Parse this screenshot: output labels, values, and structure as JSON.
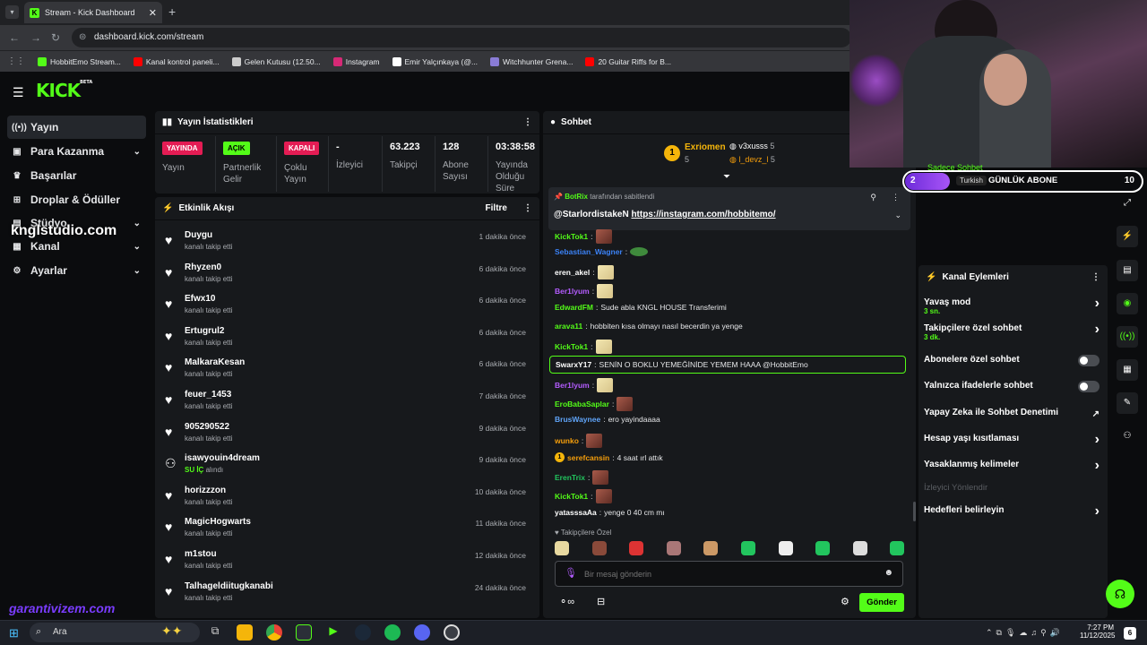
{
  "browser": {
    "tab_title": "Stream - Kick Dashboard",
    "url": "dashboard.kick.com/stream",
    "bookmarks": [
      {
        "label": "HobbitEmo Stream...",
        "color": "#53fc18"
      },
      {
        "label": "Kanal kontrol paneli...",
        "color": "#ff0000"
      },
      {
        "label": "Gelen Kutusu (12.50...",
        "color": "#cccccc"
      },
      {
        "label": "Instagram",
        "color": "#d62976"
      },
      {
        "label": "Emir Yalçınkaya (@...",
        "color": "#ffffff"
      },
      {
        "label": "Witchhunter Grena...",
        "color": "#8a7cd6"
      },
      {
        "label": "20 Guitar Riffs for B...",
        "color": "#ff0000"
      }
    ]
  },
  "brand": {
    "logo": "KICK",
    "beta": "BETA"
  },
  "sidebar": {
    "items": [
      {
        "label": "Yayın",
        "icon": "broadcast-icon",
        "glyph": "((•))"
      },
      {
        "label": "Para Kazanma",
        "icon": "money-icon",
        "glyph": "▣"
      },
      {
        "label": "Başarılar",
        "icon": "trophy-icon",
        "glyph": "♛"
      },
      {
        "label": "Droplar & Ödüller",
        "icon": "gift-icon",
        "glyph": "⊞"
      },
      {
        "label": "Stüdyo",
        "icon": "studio-icon",
        "glyph": "▤"
      },
      {
        "label": "Kanal",
        "icon": "channel-icon",
        "glyph": "▦"
      },
      {
        "label": "Ayarlar",
        "icon": "settings-icon",
        "glyph": "⚙"
      }
    ],
    "watermark": "knglstudio.com",
    "watermark2": "garantivizem.com"
  },
  "stats": {
    "title": "Yayın İstatistikleri",
    "cells": [
      {
        "badge": "YAYINDA",
        "badge_color": "#e41c54",
        "label": "Yayın"
      },
      {
        "badge": "AÇIK",
        "badge_color": "#53fc18",
        "label": "Partnerlik Gelir"
      },
      {
        "badge": "KAPALI",
        "badge_color": "#e41c54",
        "label": "Çoklu Yayın"
      },
      {
        "value": "-",
        "label": "İzleyici"
      },
      {
        "value": "63.223",
        "label": "Takipçi"
      },
      {
        "value": "128",
        "label": "Abone Sayısı"
      },
      {
        "value": "03:38:58",
        "label": "Yayında Olduğu Süre"
      }
    ]
  },
  "activity": {
    "title": "Etkinlik Akışı",
    "filter": "Filtre",
    "items": [
      {
        "name": "Duygu",
        "action": "kanalı takip etti",
        "time": "1 dakika önce"
      },
      {
        "name": "Rhyzen0",
        "action": "kanalı takip etti",
        "time": "6 dakika önce"
      },
      {
        "name": "Efwx10",
        "action": "kanalı takip etti",
        "time": "6 dakika önce"
      },
      {
        "name": "Ertugrul2",
        "action": "kanalı takip etti",
        "time": "6 dakika önce"
      },
      {
        "name": "MalkaraKesan",
        "action": "kanalı takip etti",
        "time": "6 dakika önce"
      },
      {
        "name": "feuer_1453",
        "action": "kanalı takip etti",
        "time": "7 dakika önce"
      },
      {
        "name": "905290522",
        "action": "kanalı takip etti",
        "time": "9 dakika önce"
      },
      {
        "name": "isawyouin4dream",
        "action": "alındı",
        "highlight": "SU İÇ",
        "time": "9 dakika önce"
      },
      {
        "name": "horizzzon",
        "action": "kanalı takip etti",
        "time": "10 dakika önce"
      },
      {
        "name": "MagicHogwarts",
        "action": "kanalı takip etti",
        "time": "11 dakika önce"
      },
      {
        "name": "m1stou",
        "action": "kanalı takip etti",
        "time": "12 dakika önce"
      },
      {
        "name": "Talhageldiitugkanabi",
        "action": "kanalı takip etti",
        "time": "24 dakika önce"
      }
    ]
  },
  "chat": {
    "title": "Sohbet",
    "leaders": {
      "first": {
        "name": "Exriomen",
        "count": "5",
        "rank": "1"
      },
      "second": {
        "name": "v3xusss",
        "count": "5"
      },
      "third": {
        "name": "l_devz_l",
        "count": "5"
      }
    },
    "pinned": {
      "by": "BotRix",
      "by_suffix": "tarafından sabitlendi",
      "mention": "@StarlordistakeN",
      "link": "https://instagram.com/hobbitemo/"
    },
    "messages": [
      {
        "user": "KickTok1",
        "color": "#53fc18",
        "text": "",
        "emote": "ered"
      },
      {
        "user": "Sebastian_Wagner",
        "color": "#3b82f6",
        "text": "",
        "emote": "efrog"
      },
      {
        "user": "eren_akel",
        "color": "#ffffff",
        "text": "",
        "emote": "eblonde"
      },
      {
        "user": "Ber1lyum",
        "color": "#b45cff",
        "text": "",
        "emote": "eblonde"
      },
      {
        "user": "EdwardFM",
        "color": "#53fc18",
        "text": "Sude abla KNGL HOUSE Transferimi",
        "emote": ""
      },
      {
        "user": "arava11",
        "color": "#53fc18",
        "text": "hobbiten kısa olmayı nasıl becerdin ya yenge",
        "emote": ""
      },
      {
        "user": "KickTok1",
        "color": "#53fc18",
        "text": "",
        "emote": "eblonde"
      },
      {
        "user": "SwarxY17",
        "color": "#ffffff",
        "text": "SENİN O BOKLU YEMEĞİNİDE YEMEM HAAA @HobbitEmo",
        "emote": "",
        "highlight": true
      },
      {
        "user": "Ber1lyum",
        "color": "#b45cff",
        "text": "",
        "emote": "eblonde"
      },
      {
        "user": "EroBabaSaplar",
        "color": "#53fc18",
        "text": "",
        "emote": "ered"
      },
      {
        "user": "BrusWaynee",
        "color": "#60a5fa",
        "text": "ero yayindaaaa",
        "emote": ""
      },
      {
        "user": "wunko",
        "color": "#f59e0b",
        "text": "",
        "emote": "ered"
      },
      {
        "user": "serefcansin",
        "color": "#f59e0b",
        "text": "4 saat ırl attık",
        "emote": "",
        "badge": "1"
      },
      {
        "user": "ErenTrix",
        "color": "#22c55e",
        "text": "",
        "emote": "ered"
      },
      {
        "user": "KickTok1",
        "color": "#53fc18",
        "text": "",
        "emote": "ered"
      },
      {
        "user": "yatasssaAa",
        "color": "#ffffff",
        "text": "yenge 0 40 cm mı",
        "emote": ""
      }
    ],
    "followers_only": "Takipçilere Özel",
    "input_placeholder": "Bir mesaj gönderin",
    "send_label": "Gönder"
  },
  "overlay": {
    "level": "2",
    "language": "Turkish",
    "goal": "GÜNLÜK ABONE",
    "goal_target": "10",
    "peek_text": "Sadece Sohbet"
  },
  "channel_actions": {
    "title": "Kanal Eylemleri",
    "items": [
      {
        "label": "Yavaş mod",
        "sub": "3 sn.",
        "type": "arrow"
      },
      {
        "label": "Takipçilere özel sohbet",
        "sub": "3 dk.",
        "type": "arrow"
      },
      {
        "label": "Abonelere özel sohbet",
        "sub": "",
        "type": "toggle"
      },
      {
        "label": "Yalnızca ifadelerle sohbet",
        "sub": "",
        "type": "toggle"
      },
      {
        "label": "Yapay Zeka ile Sohbet Denetimi",
        "sub": "",
        "type": "external"
      },
      {
        "label": "Hesap yaşı kısıtlaması",
        "sub": "",
        "type": "arrow"
      },
      {
        "label": "Yasaklanmış kelimeler",
        "sub": "",
        "type": "arrow"
      },
      {
        "label": "İzleyici Yönlendir",
        "sub": "",
        "type": "disabled"
      },
      {
        "label": "Hedefleri belirleyin",
        "sub": "",
        "type": "arrow"
      }
    ]
  },
  "taskbar": {
    "search": "Ara",
    "time": "7:27 PM",
    "date": "11/12/2025",
    "notif": "6"
  }
}
